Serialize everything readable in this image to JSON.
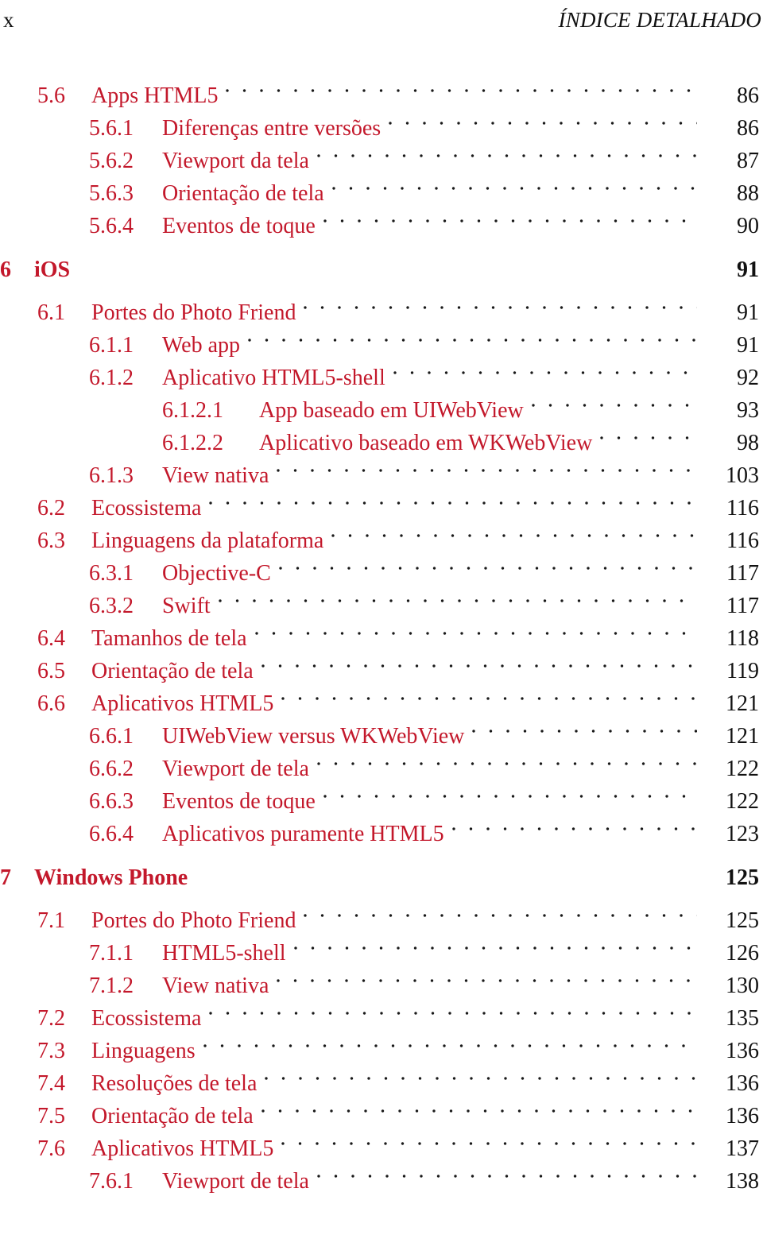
{
  "header": {
    "folio": "x",
    "title": "ÍNDICE DETALHADO"
  },
  "colors": {
    "entry_red": "#C3182B",
    "page_number": "#111111",
    "leader_dot": "#1a1a1a"
  },
  "toc": {
    "entries": [
      {
        "level": 2,
        "number": "5.6",
        "title": "Apps HTML5",
        "page": "86"
      },
      {
        "level": 3,
        "number": "5.6.1",
        "title": "Diferenças entre versões",
        "page": "86"
      },
      {
        "level": 3,
        "number": "5.6.2",
        "title": "Viewport da tela",
        "page": "87"
      },
      {
        "level": 3,
        "number": "5.6.3",
        "title": "Orientação de tela",
        "page": "88"
      },
      {
        "level": 3,
        "number": "5.6.4",
        "title": "Eventos de toque",
        "page": "90"
      },
      {
        "level": 1,
        "number": "6",
        "title": "iOS",
        "page": "91"
      },
      {
        "level": 2,
        "number": "6.1",
        "title": "Portes do Photo Friend",
        "page": "91"
      },
      {
        "level": 3,
        "number": "6.1.1",
        "title": "Web app",
        "page": "91"
      },
      {
        "level": 3,
        "number": "6.1.2",
        "title": "Aplicativo HTML5-shell",
        "page": "92"
      },
      {
        "level": 4,
        "number": "6.1.2.1",
        "title": "App baseado em UIWebView",
        "page": "93"
      },
      {
        "level": 4,
        "number": "6.1.2.2",
        "title": "Aplicativo baseado em WKWebView",
        "page": "98"
      },
      {
        "level": 3,
        "number": "6.1.3",
        "title": "View nativa",
        "page": "103"
      },
      {
        "level": 2,
        "number": "6.2",
        "title": "Ecossistema",
        "page": "116"
      },
      {
        "level": 2,
        "number": "6.3",
        "title": "Linguagens da plataforma",
        "page": "116"
      },
      {
        "level": 3,
        "number": "6.3.1",
        "title": "Objective-C",
        "page": "117"
      },
      {
        "level": 3,
        "number": "6.3.2",
        "title": "Swift",
        "page": "117"
      },
      {
        "level": 2,
        "number": "6.4",
        "title": "Tamanhos de tela",
        "page": "118"
      },
      {
        "level": 2,
        "number": "6.5",
        "title": "Orientação de tela",
        "page": "119"
      },
      {
        "level": 2,
        "number": "6.6",
        "title": "Aplicativos HTML5",
        "page": "121"
      },
      {
        "level": 3,
        "number": "6.6.1",
        "title": "UIWebView versus WKWebView",
        "page": "121"
      },
      {
        "level": 3,
        "number": "6.6.2",
        "title": "Viewport de tela",
        "page": "122"
      },
      {
        "level": 3,
        "number": "6.6.3",
        "title": "Eventos de toque",
        "page": "122"
      },
      {
        "level": 3,
        "number": "6.6.4",
        "title": "Aplicativos puramente HTML5",
        "page": "123"
      },
      {
        "level": 1,
        "number": "7",
        "title": "Windows Phone",
        "page": "125"
      },
      {
        "level": 2,
        "number": "7.1",
        "title": "Portes do Photo Friend",
        "page": "125"
      },
      {
        "level": 3,
        "number": "7.1.1",
        "title": "HTML5-shell",
        "page": "126"
      },
      {
        "level": 3,
        "number": "7.1.2",
        "title": "View nativa",
        "page": "130"
      },
      {
        "level": 2,
        "number": "7.2",
        "title": "Ecossistema",
        "page": "135"
      },
      {
        "level": 2,
        "number": "7.3",
        "title": "Linguagens",
        "page": "136"
      },
      {
        "level": 2,
        "number": "7.4",
        "title": "Resoluções de tela",
        "page": "136"
      },
      {
        "level": 2,
        "number": "7.5",
        "title": "Orientação de tela",
        "page": "136"
      },
      {
        "level": 2,
        "number": "7.6",
        "title": "Aplicativos HTML5",
        "page": "137"
      },
      {
        "level": 3,
        "number": "7.6.1",
        "title": "Viewport de tela",
        "page": "138"
      }
    ]
  }
}
